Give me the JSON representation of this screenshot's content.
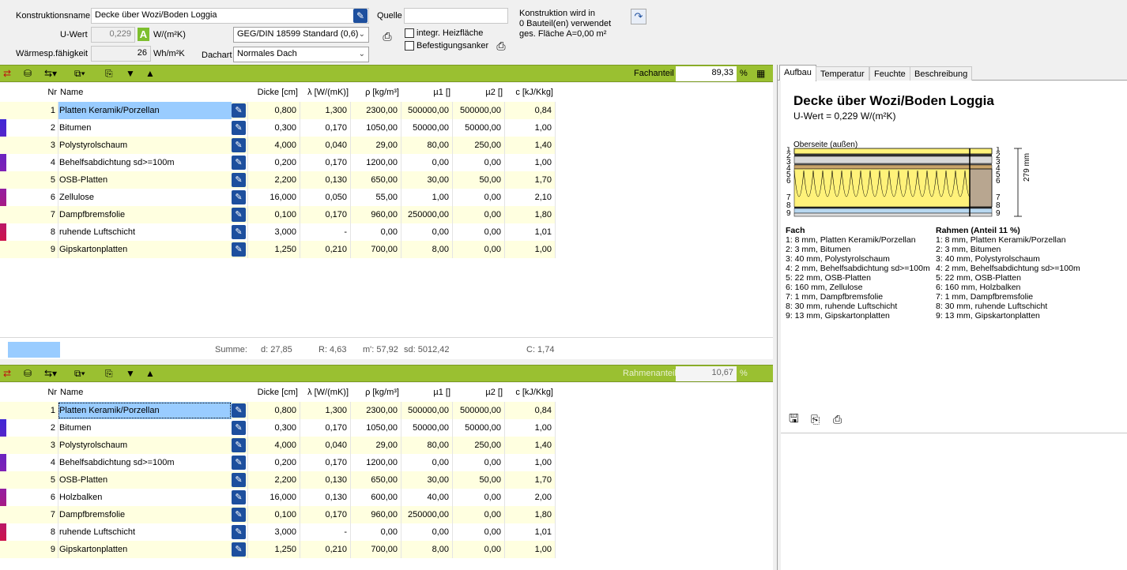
{
  "header": {
    "konstruktionsname_label": "Konstruktionsname",
    "konstruktionsname_value": "Decke über Wozi/Boden Loggia",
    "quelle_label": "Quelle",
    "quelle_value": "",
    "uwert_label": "U-Wert",
    "uwert_value": "0,229",
    "uwert_badge": "A",
    "uwert_unit": "W/(m²K)",
    "waerme_label": "Wärmesp.fähigkeit",
    "waerme_value": "26",
    "waerme_unit": "Wh/m²K",
    "standard_select": "GEG/DIN 18599 Standard (0,6)",
    "dachart_label": "Dachart",
    "dachart_select": "Normales Dach",
    "heizflaeche_label": "integr. Heizfläche",
    "befestigung_label": "Befestigungsanker",
    "info_line1": "Konstruktion wird in",
    "info_line2": "0 Bauteil(en) verwendet",
    "info_line3": "ges. Fläche A=0,00 m²"
  },
  "columns": [
    "Nr",
    "Name",
    "Dicke [cm]",
    "λ [W/(mK)]",
    "ρ [kg/m³]",
    "µ1 []",
    "µ2 []",
    "c [kJ/Kkg]"
  ],
  "fach": {
    "anteil_label": "Fachanteil",
    "anteil_value": "89,33",
    "anteil_unit": "%",
    "rows": [
      [
        "1",
        "Platten Keramik/Porzellan",
        "0,800",
        "1,300",
        "2300,00",
        "500000,00",
        "500000,00",
        "0,84"
      ],
      [
        "2",
        "Bitumen",
        "0,300",
        "0,170",
        "1050,00",
        "50000,00",
        "50000,00",
        "1,00"
      ],
      [
        "3",
        "Polystyrolschaum",
        "4,000",
        "0,040",
        "29,00",
        "80,00",
        "250,00",
        "1,40"
      ],
      [
        "4",
        "Behelfsabdichtung sd>=100m",
        "0,200",
        "0,170",
        "1200,00",
        "0,00",
        "0,00",
        "1,00"
      ],
      [
        "5",
        "OSB-Platten",
        "2,200",
        "0,130",
        "650,00",
        "30,00",
        "50,00",
        "1,70"
      ],
      [
        "6",
        "Zellulose",
        "16,000",
        "0,050",
        "55,00",
        "1,00",
        "0,00",
        "2,10"
      ],
      [
        "7",
        "Dampfbremsfolie",
        "0,100",
        "0,170",
        "960,00",
        "250000,00",
        "0,00",
        "1,80"
      ],
      [
        "8",
        "ruhende Luftschicht",
        "3,000",
        "-",
        "0,00",
        "0,00",
        "0,00",
        "1,01"
      ],
      [
        "9",
        "Gipskartonplatten",
        "1,250",
        "0,210",
        "700,00",
        "8,00",
        "0,00",
        "1,00"
      ]
    ],
    "summe_label": "Summe:",
    "summe_d": "d: 27,85",
    "summe_r": "R: 4,63",
    "summe_m": "m': 57,92",
    "summe_sd": "sd: 5012,42",
    "summe_c": "C: 1,74"
  },
  "rahmen": {
    "anteil_label": "Rahmenanteil",
    "anteil_value": "10,67",
    "anteil_unit": "%",
    "rows": [
      [
        "1",
        "Platten Keramik/Porzellan",
        "0,800",
        "1,300",
        "2300,00",
        "500000,00",
        "500000,00",
        "0,84"
      ],
      [
        "2",
        "Bitumen",
        "0,300",
        "0,170",
        "1050,00",
        "50000,00",
        "50000,00",
        "1,00"
      ],
      [
        "3",
        "Polystyrolschaum",
        "4,000",
        "0,040",
        "29,00",
        "80,00",
        "250,00",
        "1,40"
      ],
      [
        "4",
        "Behelfsabdichtung sd>=100m",
        "0,200",
        "0,170",
        "1200,00",
        "0,00",
        "0,00",
        "1,00"
      ],
      [
        "5",
        "OSB-Platten",
        "2,200",
        "0,130",
        "650,00",
        "30,00",
        "50,00",
        "1,70"
      ],
      [
        "6",
        "Holzbalken",
        "16,000",
        "0,130",
        "600,00",
        "40,00",
        "0,00",
        "2,00"
      ],
      [
        "7",
        "Dampfbremsfolie",
        "0,100",
        "0,170",
        "960,00",
        "250000,00",
        "0,00",
        "1,80"
      ],
      [
        "8",
        "ruhende Luftschicht",
        "3,000",
        "-",
        "0,00",
        "0,00",
        "0,00",
        "1,01"
      ],
      [
        "9",
        "Gipskartonplatten",
        "1,250",
        "0,210",
        "700,00",
        "8,00",
        "0,00",
        "1,00"
      ]
    ]
  },
  "tabs": [
    "Aufbau",
    "Temperatur",
    "Feuchte",
    "Beschreibung"
  ],
  "doc": {
    "title": "Decke über Wozi/Boden Loggia",
    "uwert": "U-Wert = 0,229 W/(m²K)",
    "oberseite": "Oberseite (außen)",
    "dim_label": "279 mm",
    "layer_numbers": [
      "1",
      "2",
      "3",
      "4",
      "5",
      "6",
      "7",
      "8",
      "9"
    ],
    "fach_title": "Fach",
    "fach_items": [
      "1:  8 mm, Platten Keramik/Porzellan",
      "2:  3 mm, Bitumen",
      "3:  40 mm, Polystyrolschaum",
      "4:  2 mm, Behelfsabdichtung sd>=100m",
      "5:  22 mm, OSB-Platten",
      "6:  160 mm, Zellulose",
      "7:  1 mm, Dampfbremsfolie",
      "8:  30 mm, ruhende Luftschicht",
      "9:  13 mm, Gipskartonplatten"
    ],
    "rahmen_title": "Rahmen (Anteil 11 %)",
    "rahmen_items": [
      "1:  8 mm, Platten Keramik/Porzellan",
      "2:  3 mm, Bitumen",
      "3:  40 mm, Polystyrolschaum",
      "4:  2 mm, Behelfsabdichtung sd>=100m",
      "5:  22 mm, OSB-Platten",
      "6:  160 mm, Holzbalken",
      "7:  1 mm, Dampfbremsfolie",
      "8:  30 mm, ruhende Luftschicht",
      "9:  13 mm, Gipskartonplatten"
    ]
  },
  "colors": {
    "toolbar": "#9ac031",
    "accent": "#1d4f9e",
    "rowAlt": "#ffffe0",
    "selected": "#99ccff",
    "insulation": "#fff27a"
  }
}
